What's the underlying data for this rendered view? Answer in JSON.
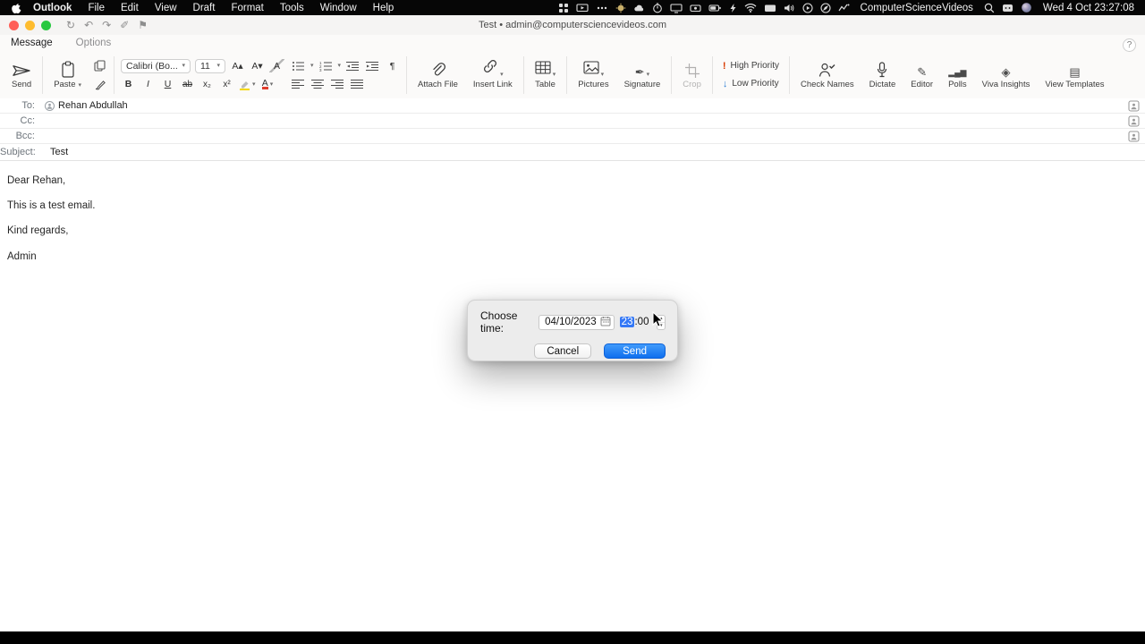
{
  "menu_bar": {
    "app_name": "Outlook",
    "menus": [
      "File",
      "Edit",
      "View",
      "Draft",
      "Format",
      "Tools",
      "Window",
      "Help"
    ],
    "status_icons": [
      "launchpad",
      "screen-mirroring",
      "more",
      "weather",
      "cloud",
      "stopwatch",
      "display",
      "camera",
      "battery",
      "bolt",
      "wifi",
      "monitor",
      "volume",
      "play",
      "browser",
      "activity",
      "search",
      "input-source",
      "assistant"
    ],
    "user_name": "ComputerScienceVideos",
    "clock": "Wed 4 Oct 23:27:08"
  },
  "window": {
    "title": "Test • admin@computersciencevideos.com"
  },
  "tabs": {
    "message": "Message",
    "options": "Options"
  },
  "ribbon": {
    "send_label": "Send",
    "paste_label": "Paste",
    "font_name": "Calibri (Bo...",
    "font_size": "11",
    "attach_file_label": "Attach File",
    "insert_link_label": "Insert Link",
    "table_label": "Table",
    "pictures_label": "Pictures",
    "signature_label": "Signature",
    "crop_label": "Crop",
    "high_priority_label": "High Priority",
    "low_priority_label": "Low Priority",
    "check_names_label": "Check Names",
    "dictate_label": "Dictate",
    "editor_label": "Editor",
    "polls_label": "Polls",
    "viva_insights_label": "Viva Insights",
    "view_templates_label": "View Templates"
  },
  "glyphs": {
    "chevron": "▾",
    "bold": "B",
    "italic": "I",
    "underline": "U",
    "strikethrough": "ab",
    "subscript": "x₂",
    "superscript": "x²",
    "grow_font": "A▴",
    "shrink_font": "A▾",
    "clear_format": "A",
    "pilcrow": "¶",
    "font_color": "A",
    "high_priority": "!",
    "low_priority": "↓",
    "editor_icon": "✎",
    "signature_icon": "✒",
    "polls_icon": "▂▄▆",
    "viva_icon": "◈",
    "templates_icon": "▤",
    "tb_sync": "↻",
    "tb_undo": "↶",
    "tb_redo": "↷",
    "tb_draw": "✐",
    "tb_flag": "⚑",
    "help": "?",
    "colon": ":",
    "stepper_up": "▲",
    "stepper_down": "▼"
  },
  "fields": {
    "to_label": "To:",
    "cc_label": "Cc:",
    "bcc_label": "Bcc:",
    "subject_label": "Subject:",
    "to_value": "Rehan Abdullah",
    "cc_value": "",
    "bcc_value": "",
    "subject_value": "Test"
  },
  "body_lines": [
    "Dear Rehan,",
    "This is a test email.",
    "Kind regards,",
    "Admin"
  ],
  "dialog": {
    "label": "Choose time:",
    "date": "04/10/2023",
    "time_hour": "23",
    "time_minute": "00",
    "cancel": "Cancel",
    "send": "Send"
  },
  "colors": {
    "accent_blue": "#157dfa",
    "selection_blue": "#3478f6",
    "high_priority_red": "#d83b01",
    "low_priority_blue": "#2b7cd3",
    "menubar_black": "#060606"
  }
}
